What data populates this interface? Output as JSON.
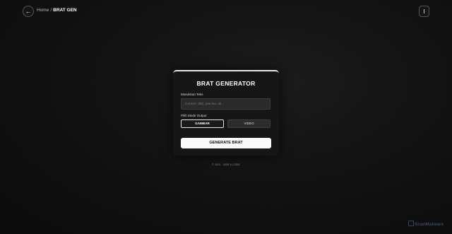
{
  "header": {
    "back_icon": "←",
    "breadcrumb_home": "Home",
    "breadcrumb_sep": "/",
    "breadcrumb_current": "BRAT GEN",
    "menu_icon": "menu-icon"
  },
  "card": {
    "title": "BRAT GENERATOR",
    "text_label": "Masukkan Teks",
    "text_placeholder": "Contoh: 360, jula kia, dll...",
    "text_value": "",
    "mode_label": "Pilih Mode Output",
    "mode_options": [
      "GAMBAR",
      "VIDEO"
    ],
    "selected_mode": "GAMBAR",
    "generate_label": "GENERATE BRAT"
  },
  "footer": {
    "copyright": "© 2021 - 2026 X-CODE"
  },
  "watermark": {
    "text": "ScanMalware"
  },
  "colors": {
    "background": "#111111",
    "card": "#161616",
    "accent": "#fafafa"
  }
}
